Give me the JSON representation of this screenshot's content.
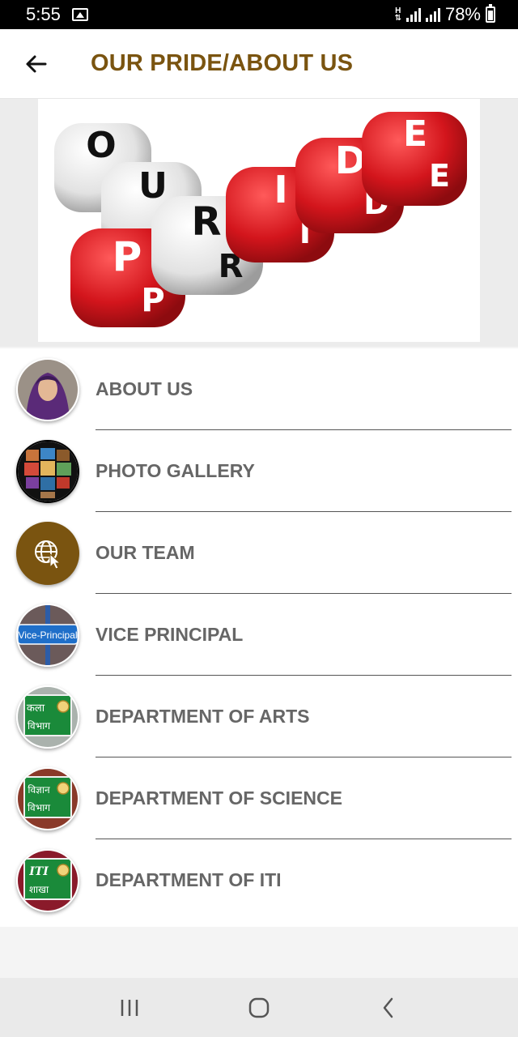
{
  "status_bar": {
    "time": "5:55",
    "network": "H",
    "battery": "78%"
  },
  "header": {
    "title": "OUR PRIDE/ABOUT US"
  },
  "banner": {
    "dice_top_row": [
      "O",
      "U"
    ],
    "dice_word": [
      "P",
      "R",
      "I",
      "D",
      "E"
    ],
    "colors": {
      "red": "#d3151c",
      "white": "#f2f2f2"
    }
  },
  "menu": {
    "items": [
      {
        "label": "ABOUT US",
        "icon": "portrait-icon"
      },
      {
        "label": "PHOTO GALLERY",
        "icon": "photo-sphere-icon"
      },
      {
        "label": "OUR TEAM",
        "icon": "globe-cursor-icon"
      },
      {
        "label": "VICE PRINCIPAL",
        "icon": "vice-principal-sign-icon",
        "icon_text": "Vice-Principal"
      },
      {
        "label": "DEPARTMENT OF ARTS",
        "icon": "arts-board-icon",
        "icon_text": [
          "कला",
          "विभाग"
        ]
      },
      {
        "label": "DEPARTMENT OF SCIENCE",
        "icon": "science-board-icon",
        "icon_text": [
          "विज्ञान",
          "विभाग"
        ]
      },
      {
        "label": "DEPARTMENT OF ITI",
        "icon": "iti-board-icon",
        "icon_text": [
          "ITI",
          "शाखा"
        ]
      }
    ]
  },
  "colors": {
    "title": "#7a5410",
    "accent_brown": "#7a5410",
    "label": "#666666"
  }
}
